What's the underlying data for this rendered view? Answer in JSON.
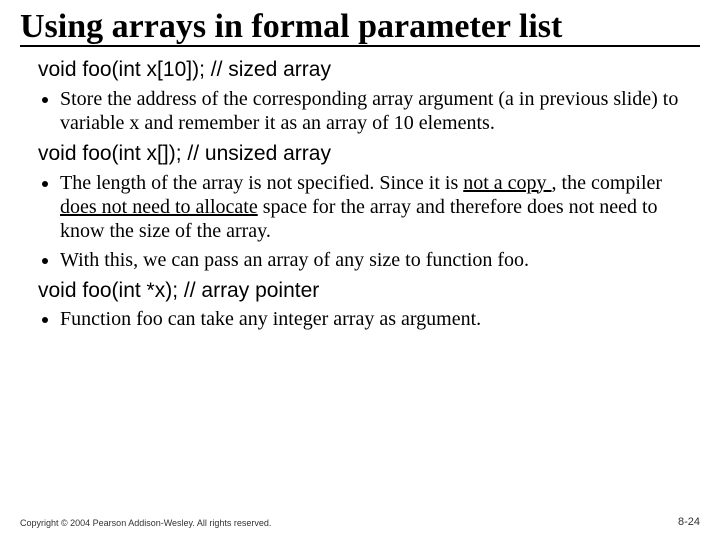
{
  "title": "Using arrays in formal parameter list",
  "sections": [
    {
      "heading": "void foo(int x[10]); // sized array",
      "bullets": [
        {
          "pre": "Store the address of the corresponding array argument (a in previous slide) to variable x and remember it as an array of 10 elements."
        }
      ]
    },
    {
      "heading": "void foo(int x[]); // unsized array",
      "bullets": [
        {
          "pre": "The length of the array is not specified. Since it is ",
          "u1": "not a copy ",
          "mid": ", the compiler ",
          "u2": "does not need to allocate",
          "post": " space for the array and therefore does not need to know the size of the array."
        },
        {
          "pre": "With this, we can pass an array of any size to function foo."
        }
      ]
    },
    {
      "heading": "void foo(int *x); // array pointer",
      "bullets": [
        {
          "pre": "Function foo can take any integer array as argument."
        }
      ]
    }
  ],
  "footer": {
    "copyright": "Copyright © 2004 Pearson Addison-Wesley. All rights reserved.",
    "page": "8-24"
  }
}
